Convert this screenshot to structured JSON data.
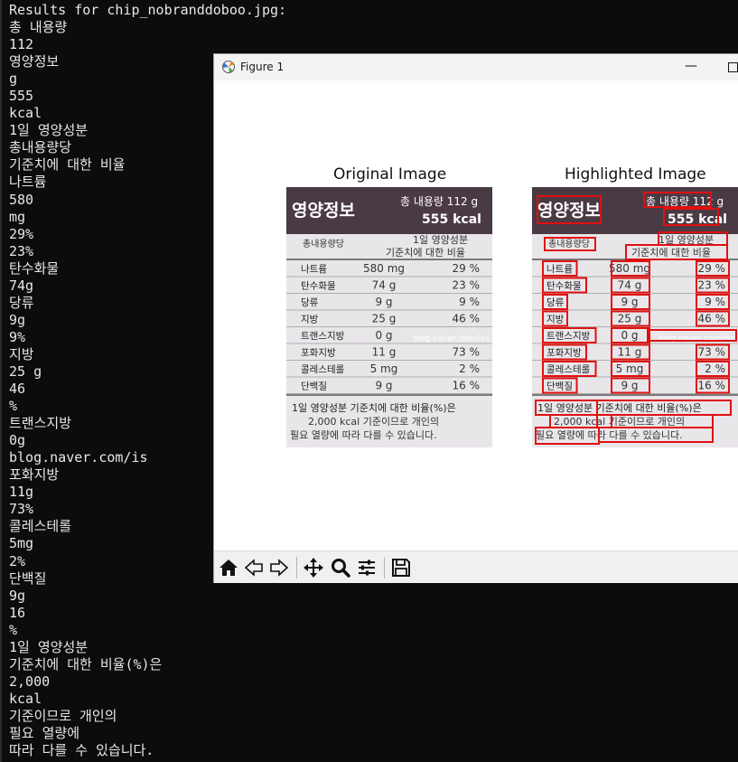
{
  "terminal": {
    "lines": [
      "Results for chip_nobranddoboo.jpg:",
      "총 내용량",
      "112",
      "영양정보",
      "g",
      "555",
      "kcal",
      "1일 영양성분",
      "총내용량당",
      "기준치에 대한 비율",
      "나트륨",
      "580",
      "mg",
      "29%",
      "23%",
      "탄수화물",
      "74g",
      "당류",
      "9g",
      "9%",
      "지방",
      "25 g",
      "46",
      "%",
      "트랜스지방",
      "0g",
      "blog.naver.com/is",
      "포화지방",
      "11g",
      "73%",
      "콜레스테롤",
      "5mg",
      "2%",
      "단백질",
      "9g",
      "16",
      "%",
      "1일 영양성분",
      "기준치에 대한 비율(%)은",
      "2,000",
      "kcal",
      "기준이므로 개인의",
      "필요 열량에",
      "따라 다를 수 있습니다."
    ]
  },
  "window": {
    "title": "Figure 1",
    "minimize": "—"
  },
  "plots": {
    "left_title": "Original Image",
    "right_title": "Highlighted Image"
  },
  "label_photo": {
    "heading": "영양정보",
    "total": "총 내용량 112 g",
    "kcal": "555 kcal",
    "daily_hdr1": "1일 영양성분",
    "daily_hdr2": "기준치에 대한 비율",
    "per_total": "총내용량당",
    "rows": [
      {
        "name": "나트륨",
        "amount": "580 mg",
        "pct": "29 %"
      },
      {
        "name": "탄수화물",
        "amount": "74 g",
        "pct": "23 %"
      },
      {
        "name": "당류",
        "amount": "9 g",
        "pct": "9 %"
      },
      {
        "name": "지방",
        "amount": "25 g",
        "pct": "46 %"
      },
      {
        "name": "트랜스지방",
        "amount": "0 g",
        "pct": ""
      },
      {
        "name": "포화지방",
        "amount": "11 g",
        "pct": "73 %"
      },
      {
        "name": "콜레스테롤",
        "amount": "5 mg",
        "pct": "2 %"
      },
      {
        "name": "단백질",
        "amount": "9 g",
        "pct": "16 %"
      }
    ],
    "watermark": "blog.naver.com/iss",
    "foot1": "1일 영양성분 기준치에 대한 비율(%)은",
    "foot2": "2,000 kcal 기준이므로 개인의",
    "foot3": "필요 열량에 따라 다를 수 있습니다."
  },
  "toolbar": {
    "buttons": [
      "home-icon",
      "back-arrow-icon",
      "forward-arrow-icon",
      "pan-icon",
      "zoom-icon",
      "configure-subplots-icon",
      "save-icon"
    ]
  },
  "colors": {
    "terminal_bg": "#0c0c0c",
    "terminal_text": "#e8e8e8",
    "highlight_box": "#e01010",
    "label_header": "#4a3a44"
  }
}
